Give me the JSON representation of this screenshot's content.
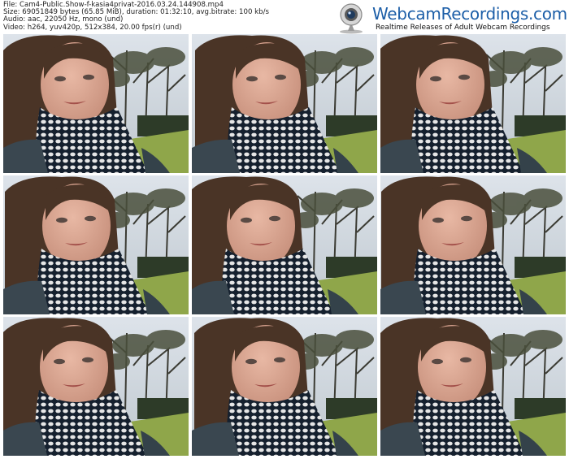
{
  "header": {
    "file_line": "File: Cam4-Public.Show-f-kasia4privat-2016.03.24.144908.mp4",
    "size_line": "Size: 69051849 bytes (65.85 MiB), duration: 01:32:10, avg.bitrate: 100 kb/s",
    "audio_line": "Audio: aac, 22050 Hz, mono (und)",
    "video_line": "Video: h264, yuv420p, 512x384, 20.00 fps(r) (und)"
  },
  "logo": {
    "title": "WebcamRecordings.com",
    "subtitle": "Realtime Releases of Adult Webcam Recordings",
    "title_color": "#1d5fa8",
    "icon": "webcam-icon"
  },
  "thumbnails": [
    {
      "index": 1
    },
    {
      "index": 2
    },
    {
      "index": 3
    },
    {
      "index": 4
    },
    {
      "index": 5
    },
    {
      "index": 6
    },
    {
      "index": 7
    },
    {
      "index": 8
    },
    {
      "index": 9
    }
  ]
}
